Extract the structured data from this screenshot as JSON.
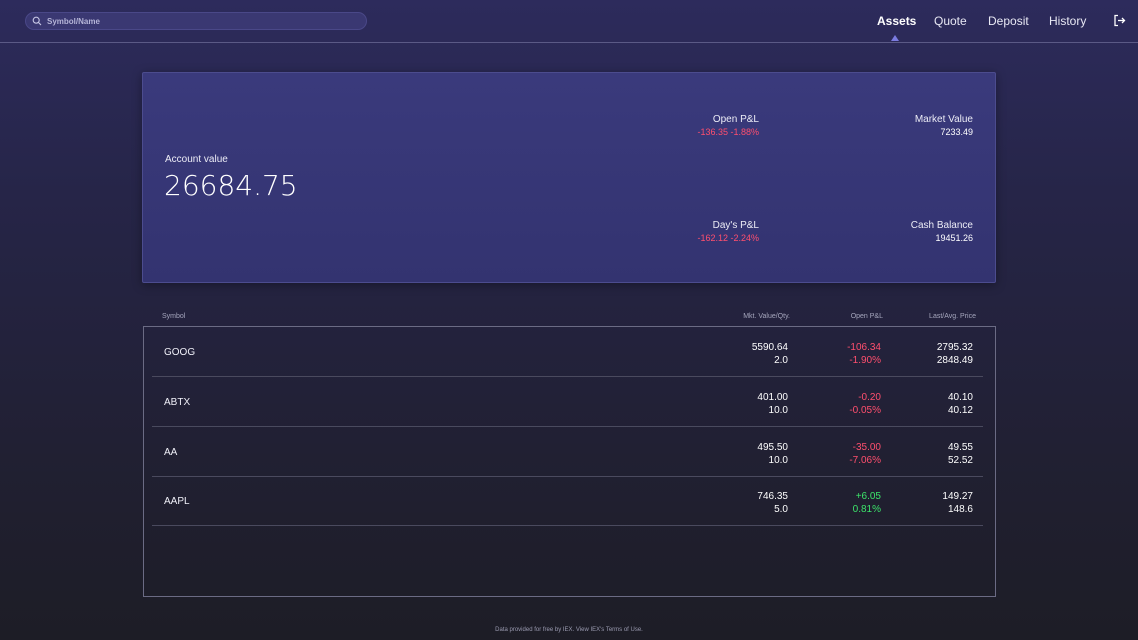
{
  "search": {
    "placeholder": "Symbol/Name"
  },
  "nav": {
    "assets": "Assets",
    "quote": "Quote",
    "deposit": "Deposit",
    "history": "History"
  },
  "summary": {
    "account_label": "Account value",
    "account_value": "26684.75",
    "open_pl": {
      "label": "Open P&L",
      "value": "-136.35 -1.88%"
    },
    "market_value": {
      "label": "Market Value",
      "value": "7233.49"
    },
    "days_pl": {
      "label": "Day's P&L",
      "value": "-162.12 -2.24%"
    },
    "cash_balance": {
      "label": "Cash Balance",
      "value": "19451.26"
    }
  },
  "table": {
    "headers": {
      "symbol": "Symbol",
      "mkt_value_qty": "Mkt. Value/Qty.",
      "open_pl": "Open P&L",
      "last_avg_price": "Last/Avg. Price"
    },
    "rows": [
      {
        "symbol": "GOOG",
        "mkt_value": "5590.64",
        "qty": "2.0",
        "pl": "-106.34",
        "pl_pct": "-1.90%",
        "last": "2795.32",
        "avg": "2848.49",
        "trend": "neg"
      },
      {
        "symbol": "ABTX",
        "mkt_value": "401.00",
        "qty": "10.0",
        "pl": "-0.20",
        "pl_pct": "-0.05%",
        "last": "40.10",
        "avg": "40.12",
        "trend": "neg"
      },
      {
        "symbol": "AA",
        "mkt_value": "495.50",
        "qty": "10.0",
        "pl": "-35.00",
        "pl_pct": "-7.06%",
        "last": "49.55",
        "avg": "52.52",
        "trend": "neg"
      },
      {
        "symbol": "AAPL",
        "mkt_value": "746.35",
        "qty": "5.0",
        "pl": "+6.05",
        "pl_pct": "0.81%",
        "last": "149.27",
        "avg": "148.6",
        "trend": "pos"
      }
    ]
  },
  "footer": {
    "text": "Data provided for free by IEX. View IEX's Terms of Use."
  },
  "colors": {
    "negative": "#ff4f6e",
    "positive": "#3ce46a",
    "accent": "#7b7be0"
  },
  "icons": {
    "search": "search-icon",
    "logout": "logout-icon"
  }
}
